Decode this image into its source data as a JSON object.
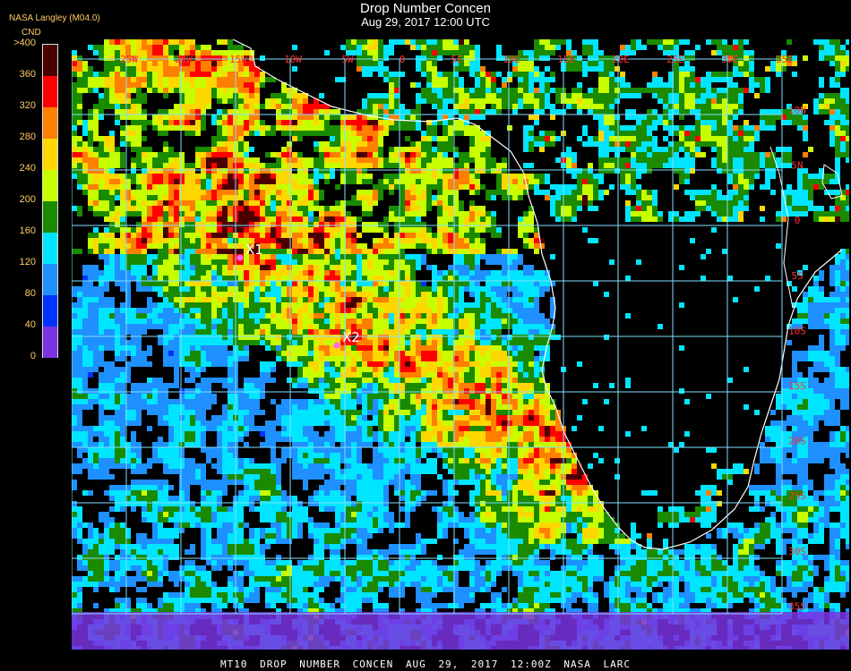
{
  "header": {
    "title": "Drop Number Concen",
    "subtitle": "Aug 29, 2017 12:00 UTC",
    "source_label": "NASA Langley (M04.0)"
  },
  "legend": {
    "title": "CND",
    "bins": [
      {
        "label": ">400",
        "color": "#4a0000"
      },
      {
        "label": "360",
        "color": "#ff0000"
      },
      {
        "label": "320",
        "color": "#ff7f00"
      },
      {
        "label": "280",
        "color": "#ffd700"
      },
      {
        "label": "240",
        "color": "#c8ff00"
      },
      {
        "label": "200",
        "color": "#1a8a00"
      },
      {
        "label": "160",
        "color": "#00e5ff"
      },
      {
        "label": "120",
        "color": "#1e90ff"
      },
      {
        "label": "80",
        "color": "#0033ff"
      },
      {
        "label": "40",
        "color": "#7a33e0"
      },
      {
        "label": "0",
        "color": "#ffffff"
      }
    ]
  },
  "map": {
    "longitude_labels": [
      "25W",
      "20W",
      "15W",
      "10W",
      "5W",
      "0",
      "5E",
      "10E",
      "15E",
      "20E",
      "25E",
      "30E",
      "35E"
    ],
    "latitude_labels": [
      "10N",
      "5N",
      "0",
      "5S",
      "10S",
      "15S",
      "20S",
      "25S",
      "30S",
      "35S",
      "40S"
    ],
    "markers": [
      {
        "label": "X1",
        "color": "#ff66ff"
      },
      {
        "label": "X2",
        "color": "#ff66ff"
      }
    ],
    "grid_color": "#7fe0ff",
    "label_color": "#ff3030",
    "coast_color": "#ffffff"
  },
  "footer": {
    "product": "MT10",
    "field": "DROP NUMBER CONCEN",
    "datetime": "AUG 29, 2017 12:00Z",
    "agency": "NASA LARC"
  }
}
